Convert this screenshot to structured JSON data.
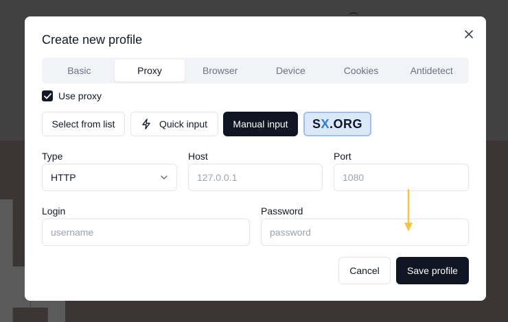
{
  "modal": {
    "title": "Create new profile"
  },
  "tabs": [
    {
      "label": "Basic",
      "active": false
    },
    {
      "label": "Proxy",
      "active": true
    },
    {
      "label": "Browser",
      "active": false
    },
    {
      "label": "Device",
      "active": false
    },
    {
      "label": "Cookies",
      "active": false
    },
    {
      "label": "Antidetect",
      "active": false
    }
  ],
  "proxy": {
    "use_proxy_label": "Use proxy",
    "use_proxy_checked": true,
    "select_from_list_label": "Select from list",
    "quick_input_label": "Quick input",
    "manual_input_label": "Manual input",
    "provider": {
      "pre": "S",
      "x": "X",
      "post": ".ORG"
    }
  },
  "fields": {
    "type": {
      "label": "Type",
      "value": "HTTP"
    },
    "host": {
      "label": "Host",
      "placeholder": "127.0.0.1"
    },
    "port": {
      "label": "Port",
      "placeholder": "1080"
    },
    "login": {
      "label": "Login",
      "placeholder": "username"
    },
    "password": {
      "label": "Password",
      "placeholder": "password"
    }
  },
  "actions": {
    "cancel_label": "Cancel",
    "save_label": "Save profile"
  },
  "colors": {
    "primary_dark": "#0f1522",
    "provider_bg": "#dbe7fb",
    "hint_arrow": "#f5c542"
  }
}
